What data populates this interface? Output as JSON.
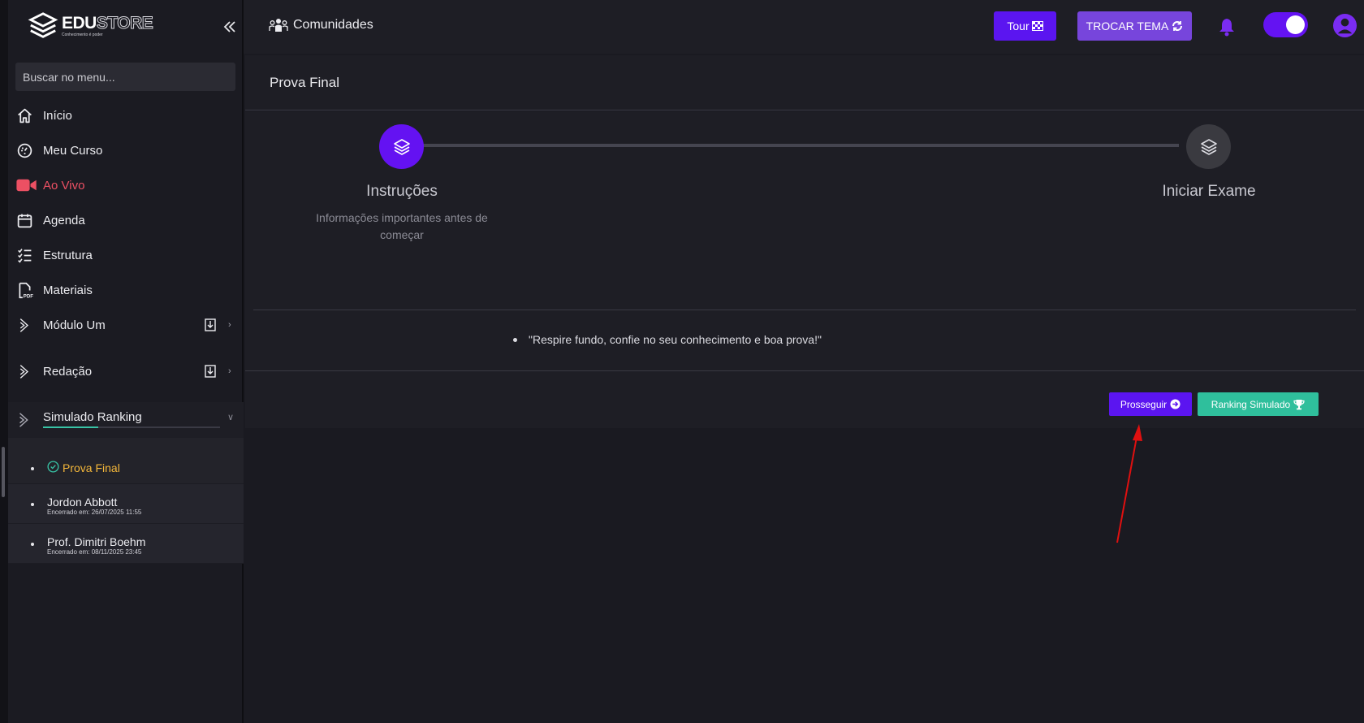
{
  "brand": {
    "word_a": "EDU",
    "word_b": "STORE",
    "tagline": "Conhecimento é poder"
  },
  "sidebar": {
    "search_placeholder": "Buscar no menu...",
    "items": [
      {
        "label": "Início",
        "icon": "home-icon"
      },
      {
        "label": "Meu Curso",
        "icon": "dashboard-icon"
      },
      {
        "label": "Ao Vivo",
        "icon": "video-camera-icon"
      },
      {
        "label": "Agenda",
        "icon": "calendar-icon"
      },
      {
        "label": "Estrutura",
        "icon": "checklist-icon"
      },
      {
        "label": "Materiais",
        "icon": "pdf-file-icon"
      },
      {
        "label": "Módulo Um",
        "icon": "chevron-right-icon"
      },
      {
        "label": "Redação",
        "icon": "chevron-right-icon"
      }
    ],
    "ranking": {
      "label": "Simulado Ranking",
      "progress": 0.31,
      "sub_items": [
        {
          "title": "Prova Final",
          "subtitle": ""
        },
        {
          "title": "Jordon Abbott",
          "subtitle": "Encerrado em: 26/07/2025 11:55"
        },
        {
          "title": "Prof. Dimitri Boehm",
          "subtitle": "Encerrado em: 08/11/2025 23:45"
        }
      ]
    }
  },
  "topbar": {
    "community_label": "Comunidades",
    "tour_label": "Tour",
    "theme_label": "TROCAR TEMA",
    "toggle_on": true
  },
  "main": {
    "page_title": "Prova Final",
    "steps": [
      {
        "title": "Instruções",
        "description": "Informações importantes antes de começar",
        "active": true
      },
      {
        "title": "Iniciar Exame",
        "description": "",
        "active": false
      }
    ],
    "instructions": [
      "\"Respire fundo, confie no seu conhecimento e boa prova!\""
    ],
    "next_label": "Prosseguir",
    "ranking_label": "Ranking Simulado"
  },
  "colors": {
    "primary": "#5b15f0",
    "theme_button": "#7745dc",
    "teal": "#2fbf9c",
    "live_red": "#ec5063",
    "active_item": "#f4b73a",
    "annotation": "#e01010"
  }
}
